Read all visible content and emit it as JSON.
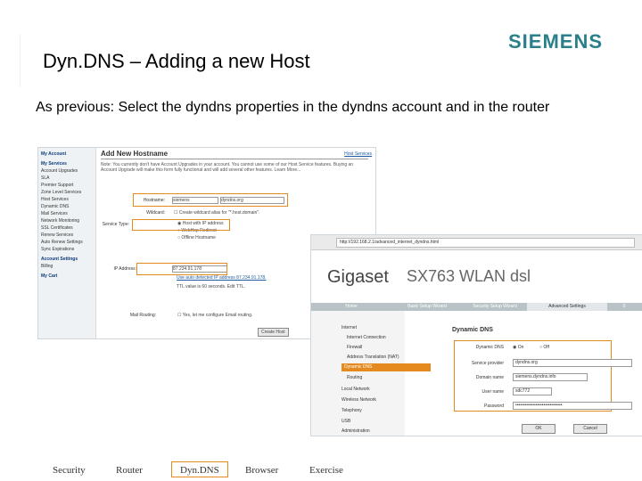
{
  "title": "Dyn.DNS – Adding a new Host",
  "logo": "SIEMENS",
  "subtitle": "As previous: Select the dyndns properties in the dyndns account and in the router",
  "dyndns": {
    "sidebar": [
      "My Account",
      "My Services",
      "Account Upgrades",
      "SLA",
      "Premier Support",
      "Zone Level Services",
      "Host Services",
      "Dynamic DNS",
      "Mail Services",
      "Network Monitoring",
      "SSL Certificates",
      "Renew Services",
      "Auto Renew Settings",
      "Sync Expirations",
      "Account Settings",
      "Billing",
      "My Cart"
    ],
    "header": "Add New Hostname",
    "help_link": "Host Services",
    "intro": "Note: You currently don't have Account Upgrades in your account. You cannot use some of our Host Service features. Buying an Account Upgrade will make this form fully functional and will add several other features. Learn More...",
    "hostname_label": "Hostname:",
    "hostname_value": "siemens",
    "domain_value": "dyndns.org",
    "wildcard_label": "Wildcard:",
    "wildcard_text": "Create wildcard alias for \"*.host.domain\".",
    "service_label": "Service Type:",
    "service_options": [
      "Host with IP address",
      "WebHop Redirect",
      "Offline Hostname"
    ],
    "ip_label": "IP Address:",
    "ip_value": "87.234.91.178",
    "ip_link": "Use auto detected IP address 87.234.91.178.",
    "ttl_text": "TTL value is 60 seconds. Edit TTL.",
    "mail_label": "Mail Routing:",
    "mail_text": "Yes, let me configure Email routing.",
    "create_button": "Create Host"
  },
  "gigaset": {
    "url": "http://192.168.2.1/advanced_internet_dyndns.html",
    "brand": "Gigaset",
    "model": "SX763 WLAN dsl",
    "tabs": [
      "Home",
      "Basic Setup Wizard",
      "Security Setup Wizard",
      "Advanced Settings",
      "S"
    ],
    "nav": [
      "Internet",
      "Internet Connection",
      "Firewall",
      "Address Translation (NAT)",
      "Dynamic DNS",
      "Routing",
      "Local Network",
      "Wireless Network",
      "Telephony",
      "USB",
      "Administration"
    ],
    "section": "Dynamic DNS",
    "dyn_label": "Dynamic DNS",
    "on": "On",
    "off": "Off",
    "provider_label": "Service provider",
    "provider_value": "dyndns.org",
    "domain_label": "Domain name",
    "domain_value": "siemens.dyndns.info",
    "user_label": "User name",
    "user_value": "sdc772",
    "pass_label": "Password",
    "pass_value": "••••••••••••••••••••••••••••••",
    "ok": "OK",
    "cancel": "Cancel"
  },
  "footer": [
    "Security",
    "Router",
    "Dyn.DNS",
    "Browser",
    "Exercise"
  ],
  "colors": {
    "accent": "#e58a1f",
    "logo": "#2a7f8a"
  }
}
